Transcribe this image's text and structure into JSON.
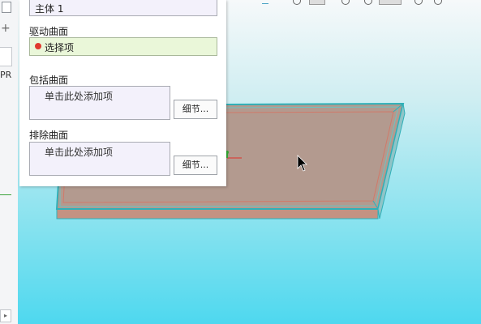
{
  "panel": {
    "body_field_value": "主体 1",
    "driving_surface": {
      "label": "驱动曲面",
      "selector_text": "选择项"
    },
    "include_surfaces": {
      "label": "包括曲面",
      "placeholder": "单击此处添加项",
      "details_button": "细节..."
    },
    "exclude_surfaces": {
      "label": "排除曲面",
      "placeholder": "单击此处添加项",
      "details_button": "细节..."
    }
  },
  "left_strip": {
    "truncated_label": "PR"
  },
  "colors": {
    "selector_bg": "#eaf7d9",
    "selector_dot": "#e03a2f",
    "panel_field_bg": "#f3f1fb",
    "model_face": "#b39a8f",
    "model_edge": "#2fb0b8"
  }
}
